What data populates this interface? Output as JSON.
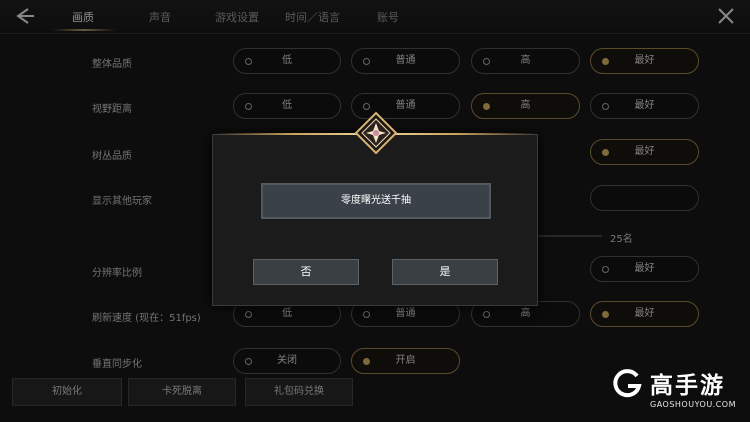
{
  "nav": {
    "tabs": [
      {
        "label": "画质",
        "active": true
      },
      {
        "label": "声音",
        "active": false
      },
      {
        "label": "游戏设置",
        "active": false
      },
      {
        "label": "时间／语言",
        "active": false
      },
      {
        "label": "账号",
        "active": false
      }
    ],
    "back_icon": "back-arrow-icon",
    "close_icon": "close-icon"
  },
  "settings": {
    "rows": [
      {
        "label": "整体品质",
        "options": [
          "低",
          "普通",
          "高",
          "最好"
        ],
        "selected": "最好"
      },
      {
        "label": "视野距离",
        "options": [
          "低",
          "普通",
          "高",
          "最好"
        ],
        "selected": "高"
      },
      {
        "label": "树丛品质",
        "options": [
          "最好"
        ],
        "selected": "最好"
      },
      {
        "label": "显示其他玩家",
        "options": [],
        "selected": null
      },
      {
        "label": "分辨率比例",
        "options": [
          "最好"
        ],
        "selected": null
      },
      {
        "label": "刷新速度 (现在：51fps)",
        "options": [
          "低",
          "普通",
          "高",
          "最好"
        ],
        "selected": "最好"
      },
      {
        "label": "垂直同步化",
        "options": [
          "关闭",
          "开启"
        ],
        "selected": "开启"
      }
    ],
    "player_count": "25名"
  },
  "dialog": {
    "message": "零度曙光送千抽",
    "no_label": "否",
    "yes_label": "是"
  },
  "bottom_buttons": [
    "初始化",
    "卡死脱离",
    "礼包码兑换"
  ],
  "watermark": {
    "title": "高手游",
    "url": "GAOSHOUYOU.COM"
  },
  "colors": {
    "accent_gold": "#c7a35a",
    "background": "#141414",
    "dialog_button": "#3a3f44"
  }
}
